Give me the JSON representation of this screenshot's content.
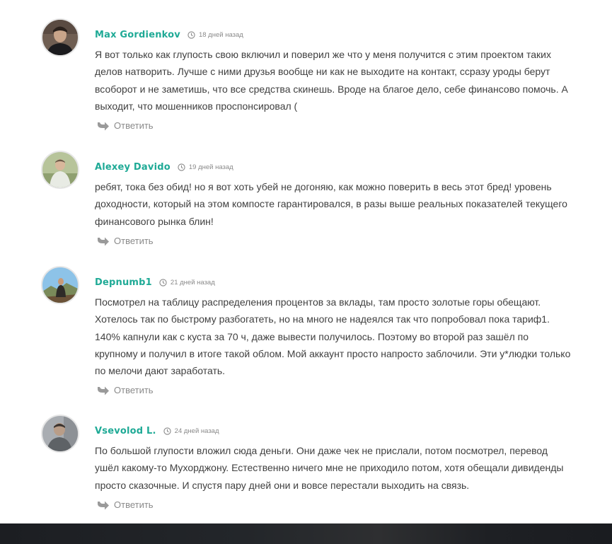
{
  "comments": [
    {
      "author": "Max Gordienkov",
      "time": "18 дней назад",
      "text": "Я вот только как глупость свою включил и поверил же что у меня получится с этим проектом таких делов натворить. Лучше с ними друзья вообще ни как не выходите на контакт, ссразу уроды берут всоборот и не заметишь, что все средства скинешь. Вроде на благое дело, себе финансово помочь. А выходит, что мошенников проспонсировал (",
      "reply": "Ответить"
    },
    {
      "author": "Alexey Davido",
      "time": "19 дней назад",
      "text": "ребят, тока без обид! но я вот хоть убей не догоняю, как можно поверить в весь этот бред! уровень доходности, который на этом компосте гарантировался, в разы выше реальных показателей текущего финансового рынка блин!",
      "reply": "Ответить"
    },
    {
      "author": "Depnumb1",
      "time": "21 дней назад",
      "text": "Посмотрел на таблицу распределения процентов за вклады, там просто золотые горы обещают. Хотелось так по быстрому разбогатеть, но на много не надеялся так что попробовал пока тариф1. 140% капнули как с куста за 70 ч, даже вывести получилось. Поэтому во второй раз зашёл по крупному и получил в итоге такой облом. Мой аккаунт просто напросто заблочили. Эти у*людки только по мелочи дают заработать.",
      "reply": "Ответить"
    },
    {
      "author": "Vsevolod L.",
      "time": "24 дней назад",
      "text": "По большой глупости вложил сюда деньги. Они даже чек не прислали, потом посмотрел, перевод ушёл какому-то Мухорджону. Естественно ничего мне не приходило потом, хотя обещали дивиденды просто сказочные. И спустя пару дней они и вовсе перестали выходить на связь.",
      "reply": "Ответить"
    }
  ],
  "icons": {
    "time": "clock-icon",
    "reply": "reply-arrow-icon"
  },
  "colors": {
    "author": "#1faa96",
    "muted": "#8a8a8a",
    "text": "#3f3f3f",
    "footer": "#1c1e22"
  }
}
